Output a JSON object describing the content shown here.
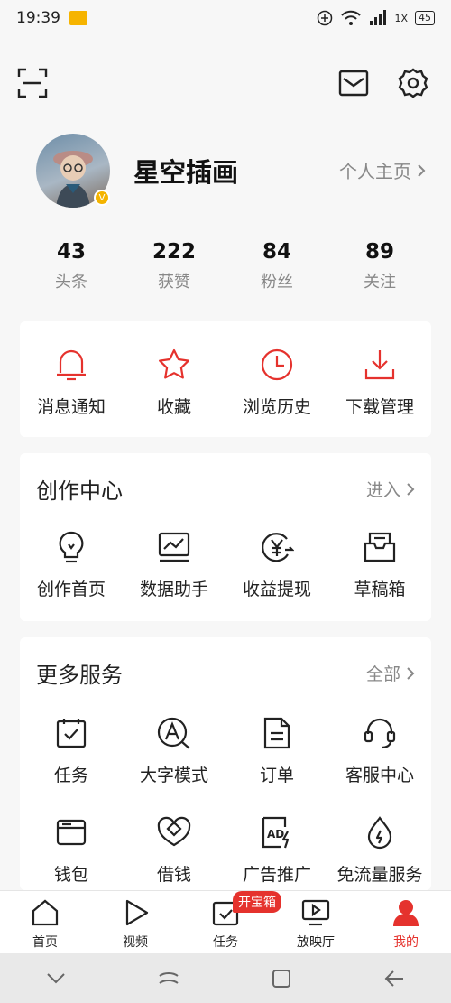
{
  "status_bar": {
    "time": "19:39",
    "signal_text": "1X",
    "battery": "45"
  },
  "profile": {
    "name": "星空插画",
    "homepage_label": "个人主页",
    "verified_mark": "V"
  },
  "stats": [
    {
      "value": "43",
      "label": "头条"
    },
    {
      "value": "222",
      "label": "获赞"
    },
    {
      "value": "84",
      "label": "粉丝"
    },
    {
      "value": "89",
      "label": "关注"
    }
  ],
  "quick_actions": [
    {
      "label": "消息通知",
      "icon": "bell-icon"
    },
    {
      "label": "收藏",
      "icon": "star-icon"
    },
    {
      "label": "浏览历史",
      "icon": "clock-icon"
    },
    {
      "label": "下载管理",
      "icon": "download-icon"
    }
  ],
  "creation_center": {
    "title": "创作中心",
    "more_label": "进入",
    "items": [
      {
        "label": "创作首页",
        "icon": "lightbulb-icon"
      },
      {
        "label": "数据助手",
        "icon": "chart-icon"
      },
      {
        "label": "收益提现",
        "icon": "yen-icon"
      },
      {
        "label": "草稿箱",
        "icon": "inbox-icon"
      }
    ]
  },
  "more_services": {
    "title": "更多服务",
    "more_label": "全部",
    "items": [
      {
        "label": "任务",
        "icon": "task-icon"
      },
      {
        "label": "大字模式",
        "icon": "large-font-icon"
      },
      {
        "label": "订单",
        "icon": "order-icon"
      },
      {
        "label": "客服中心",
        "icon": "headset-icon"
      },
      {
        "label": "钱包",
        "icon": "wallet-icon"
      },
      {
        "label": "借钱",
        "icon": "loan-icon"
      },
      {
        "label": "广告推广",
        "icon": "ad-icon"
      },
      {
        "label": "免流量服务",
        "icon": "data-free-icon"
      }
    ]
  },
  "tabbar": {
    "tabs": [
      {
        "label": "首页",
        "icon": "home-icon"
      },
      {
        "label": "视频",
        "icon": "play-icon"
      },
      {
        "label": "任务",
        "icon": "task-icon",
        "badge": "开宝箱"
      },
      {
        "label": "放映厅",
        "icon": "screen-icon"
      },
      {
        "label": "我的",
        "icon": "person-icon"
      }
    ],
    "active_index": 4
  },
  "colors": {
    "accent": "#e5322d",
    "text": "#222222",
    "muted": "#888888",
    "background": "#f7f7f7"
  }
}
